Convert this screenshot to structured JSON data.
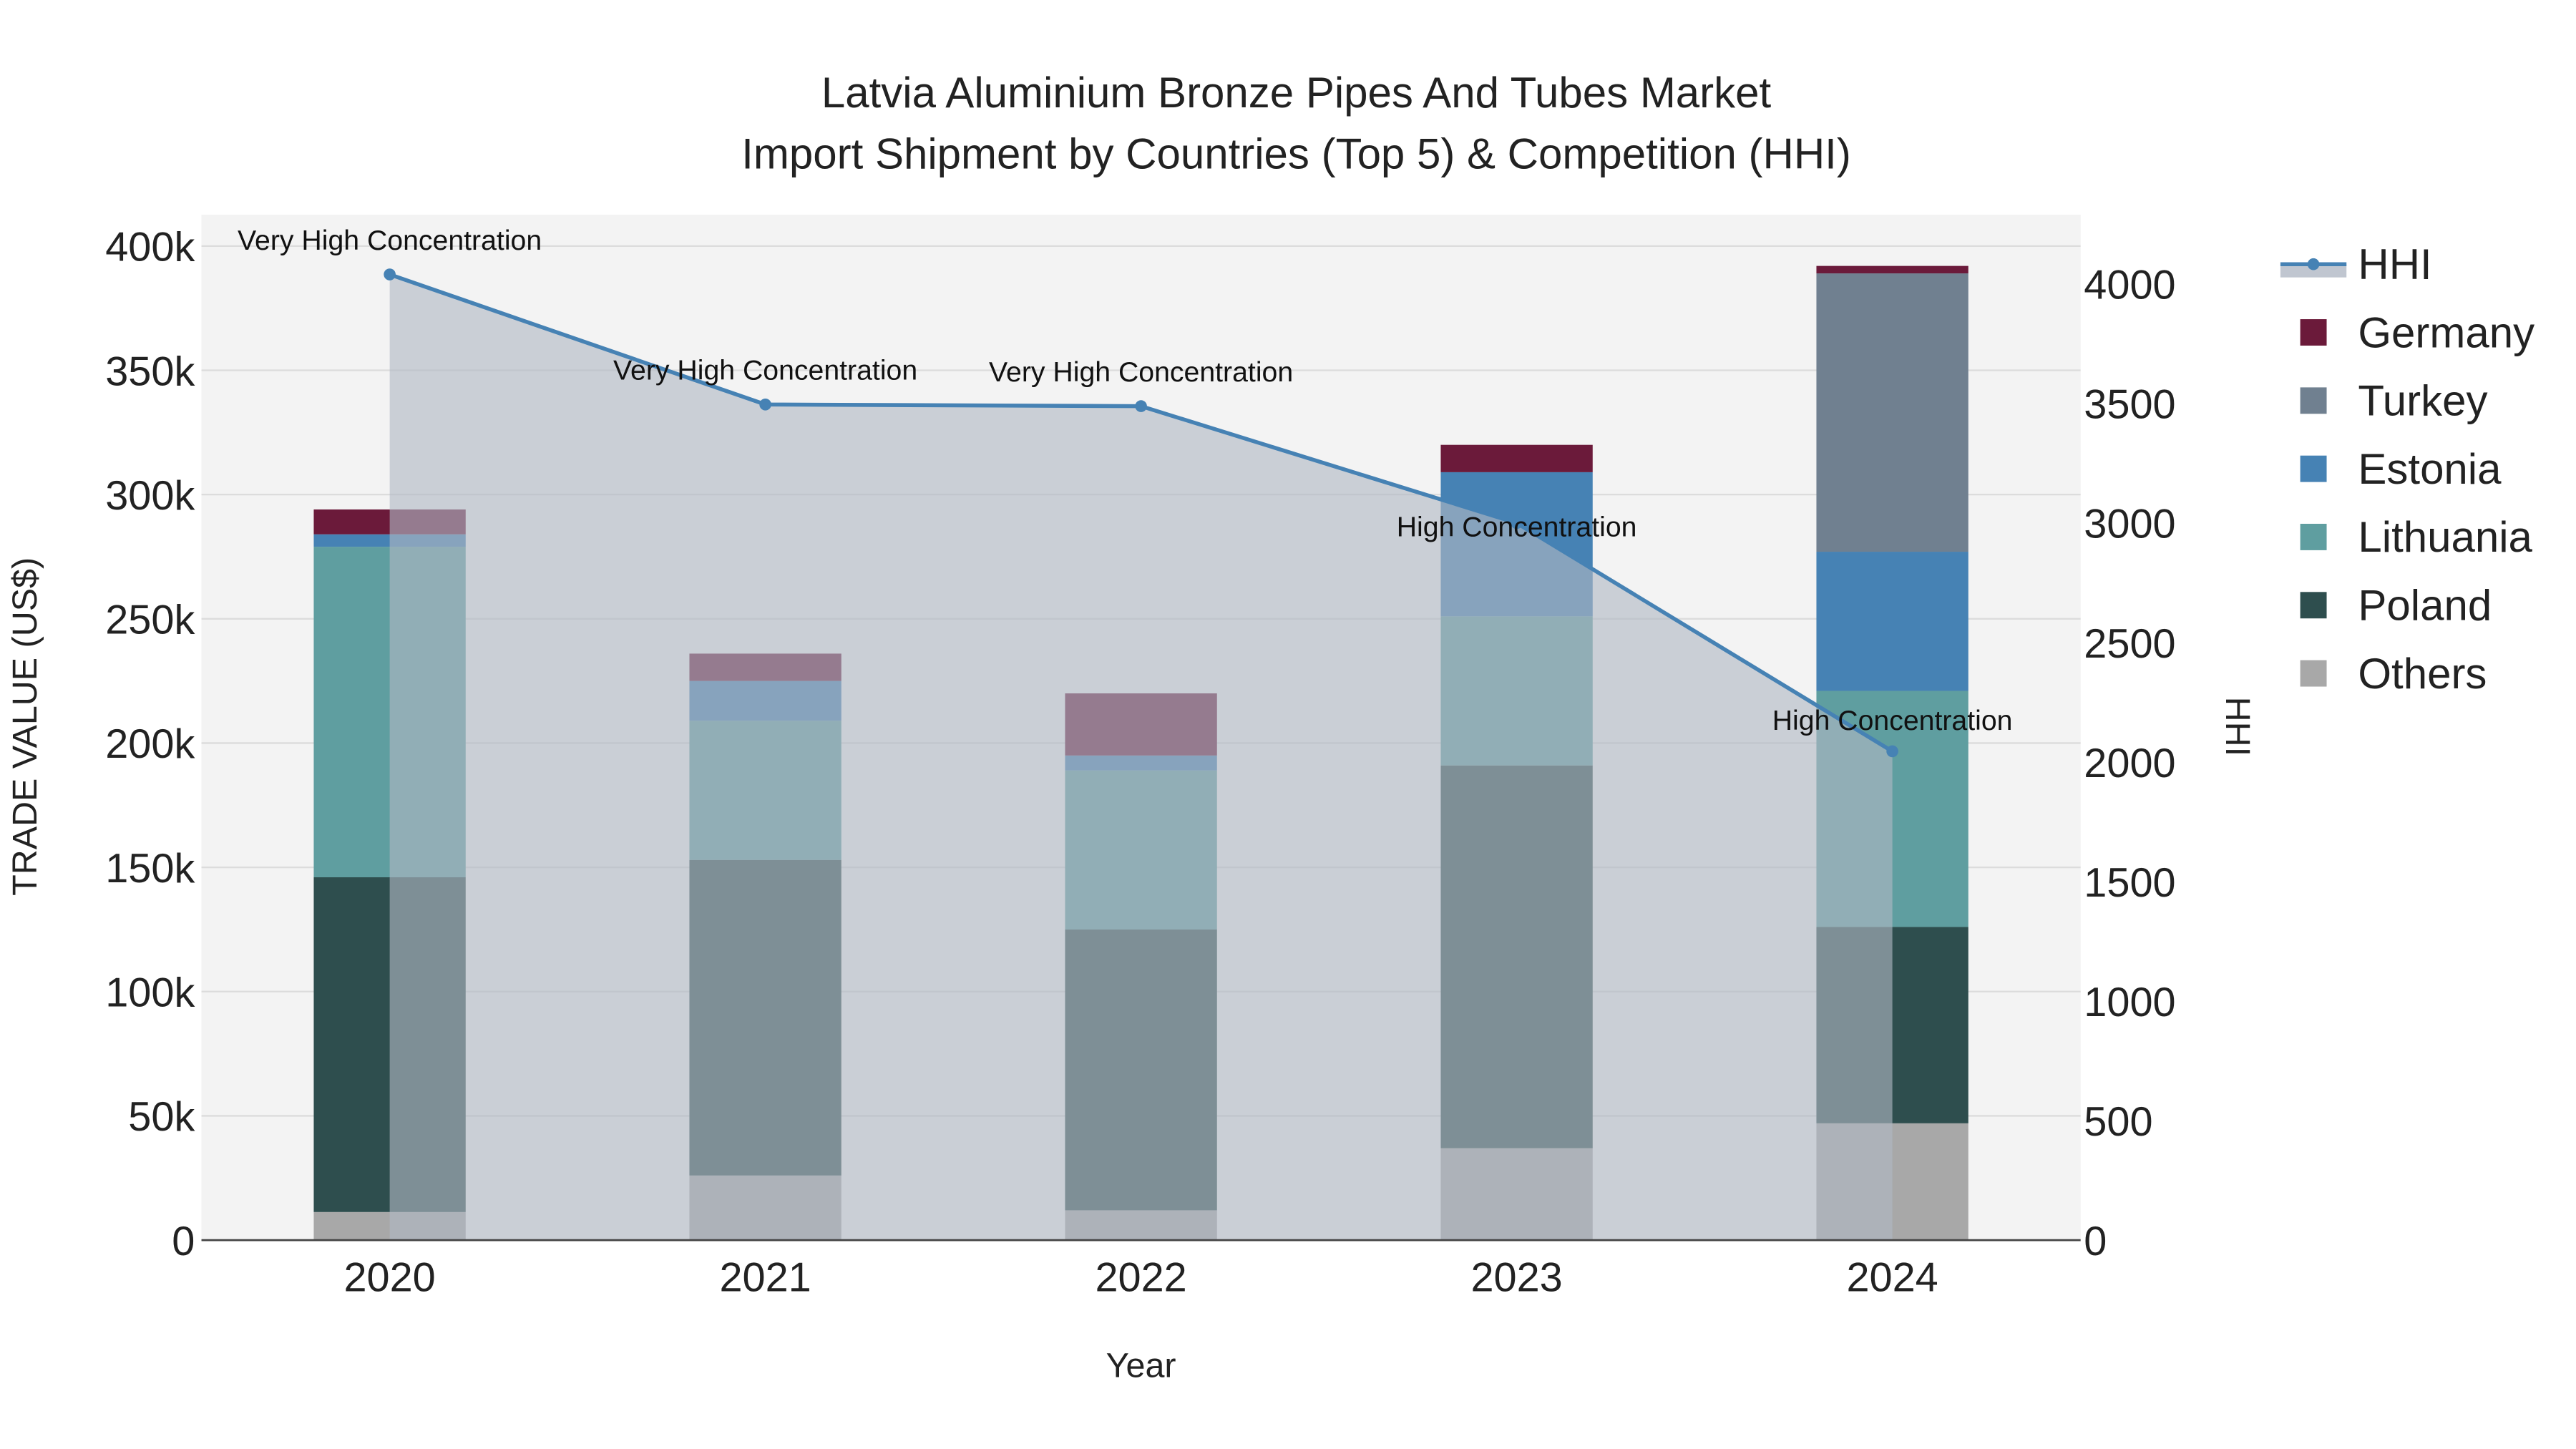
{
  "chart_data": {
    "type": "bar",
    "title": [
      "Latvia Aluminium Bronze Pipes And Tubes Market",
      "Import Shipment by Countries (Top 5) & Competition (HHI)"
    ],
    "xlabel": "Year",
    "ylabel": "TRADE VALUE (US$)",
    "y2label": "HHI",
    "categories": [
      "2020",
      "2021",
      "2022",
      "2023",
      "2024"
    ],
    "ylim": [
      0,
      400000
    ],
    "yticks": [
      0,
      50000,
      100000,
      150000,
      200000,
      250000,
      300000,
      350000,
      400000
    ],
    "ytick_labels": [
      "0",
      "50k",
      "100k",
      "150k",
      "200k",
      "250k",
      "300k",
      "350k",
      "400k"
    ],
    "y2lim": [
      0,
      4000
    ],
    "y2ticks": [
      0,
      500,
      1000,
      1500,
      2000,
      2500,
      3000,
      3500,
      4000
    ],
    "y2tick_labels": [
      "0",
      "500",
      "1000",
      "1500",
      "2000",
      "2500",
      "3000",
      "3500",
      "4000"
    ],
    "series": [
      {
        "name": "Others",
        "color": "#a8a8a8",
        "values": [
          11300,
          26000,
          12000,
          37000,
          47000
        ]
      },
      {
        "name": "Poland",
        "color": "#2e4e4e",
        "values": [
          134700,
          127000,
          113000,
          154000,
          79000
        ]
      },
      {
        "name": "Lithuania",
        "color": "#5f9ea0",
        "values": [
          133000,
          56000,
          64000,
          60000,
          95000
        ]
      },
      {
        "name": "Estonia",
        "color": "#4682b4",
        "values": [
          5000,
          16000,
          6000,
          58000,
          56000
        ]
      },
      {
        "name": "Turkey",
        "color": "#708090",
        "values": [
          0,
          0,
          0,
          0,
          112000
        ]
      },
      {
        "name": "Germany",
        "color": "#6b1a3a",
        "values": [
          10000,
          11000,
          25000,
          11000,
          3000
        ]
      }
    ],
    "hhi": {
      "name": "HHI",
      "color": "#4682b4",
      "values": [
        4040,
        3496,
        3489,
        3000,
        2045
      ],
      "annotations": [
        "Very High Concentration",
        "Very High Concentration",
        "Very High Concentration",
        "High Concentration",
        "High Concentration"
      ]
    },
    "legend_order": [
      "HHI",
      "Germany",
      "Turkey",
      "Estonia",
      "Lithuania",
      "Poland",
      "Others"
    ],
    "legend_position": "right",
    "grid": true
  }
}
